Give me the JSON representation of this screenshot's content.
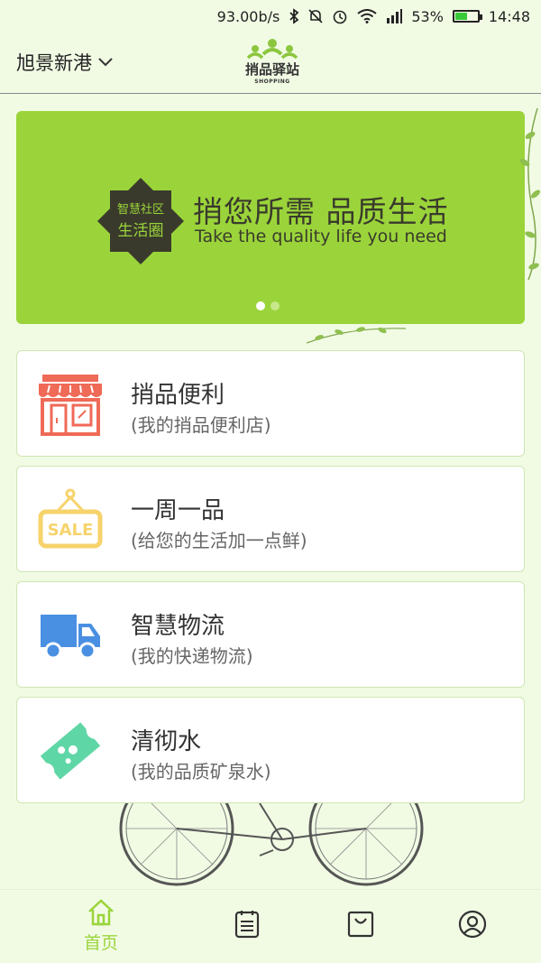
{
  "status_bar": {
    "net_speed": "93.00b/s",
    "battery_percent": "53%",
    "battery_level": 0.53,
    "time": "14:48",
    "icons": [
      "bluetooth-icon",
      "mute-icon",
      "alarm-icon",
      "wifi-icon",
      "signal-icon",
      "battery-icon"
    ]
  },
  "header": {
    "location": "旭景新港",
    "logo_text": "捎品驿站",
    "logo_sub": "SHOPPING"
  },
  "banner": {
    "badge_line1": "智慧社区",
    "badge_line2": "生活圈",
    "title": "捎您所需 品质生活",
    "subtitle": "Take the quality  life you need",
    "slide_count": 2,
    "active_slide": 0
  },
  "menu": [
    {
      "title": "捎品便利",
      "subtitle": "(我的捎品便利店)",
      "icon": "store-icon"
    },
    {
      "title": "一周一品",
      "subtitle": "(给您的生活加一点鲜)",
      "icon": "sale-sign-icon"
    },
    {
      "title": "智慧物流",
      "subtitle": "(我的快递物流)",
      "icon": "delivery-truck-icon"
    },
    {
      "title": "清彻水",
      "subtitle": "(我的品质矿泉水)",
      "icon": "water-ticket-icon"
    }
  ],
  "tabbar": {
    "home_label": "首页",
    "tabs": [
      "home-icon",
      "orders-icon",
      "bag-icon",
      "profile-icon"
    ]
  },
  "colors": {
    "accent": "#9ad43a",
    "background": "#f1fbe4",
    "store_icon": "#ef6a57",
    "sale_icon": "#f6d36b",
    "truck_icon": "#4a90e2",
    "water_icon": "#5fd6a6"
  }
}
